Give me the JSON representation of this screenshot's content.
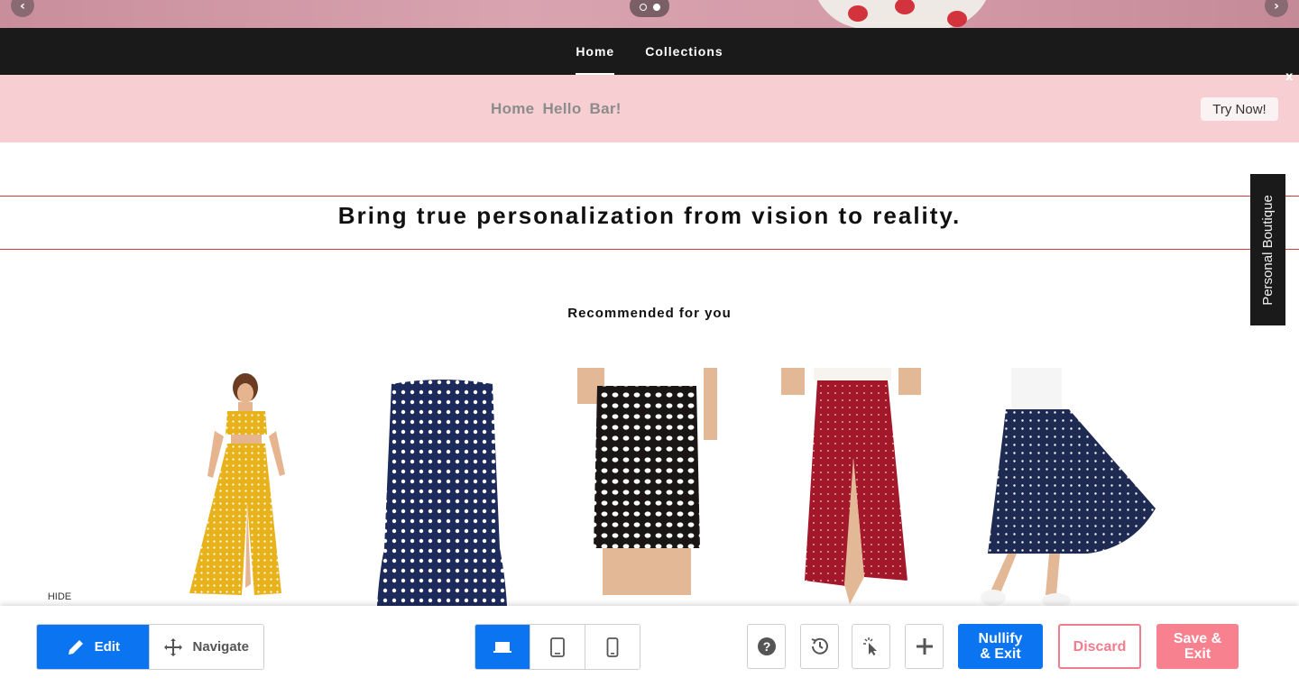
{
  "hero": {
    "prev_icon": "chevron-left-icon",
    "next_icon": "chevron-right-icon",
    "prev_glyph": "‹",
    "next_glyph": "›",
    "slides": 2,
    "active_slide": 2
  },
  "nav": {
    "items": [
      {
        "label": "Home",
        "active": true
      },
      {
        "label": "Collections",
        "active": false
      }
    ]
  },
  "hello_bar": {
    "text": "Home Hello Bar!",
    "cta": "Try Now!",
    "close": "x",
    "background": "#f7cfd2"
  },
  "tagline": "Bring true personalization from vision to reality.",
  "side_tab": "Personal Boutique",
  "recommended": {
    "title": "Recommended for you",
    "products": [
      {
        "name": "yellow-polka-dot-dress",
        "color": "#e8b21b"
      },
      {
        "name": "navy-polka-dot-mermaid-skirt",
        "color": "#1d2a5c"
      },
      {
        "name": "black-polka-dot-pencil-skirt",
        "color": "#1a1616"
      },
      {
        "name": "red-polka-dot-wrap-skirt",
        "color": "#a3172b"
      },
      {
        "name": "navy-polka-dot-midi-skirt",
        "color": "#1e2a52"
      }
    ]
  },
  "toolbar": {
    "hide": "HIDE",
    "mode": {
      "edit": "Edit",
      "edit_icon": "pencil-icon",
      "navigate": "Navigate",
      "navigate_icon": "move-arrows-icon",
      "active": "Edit"
    },
    "devices": [
      {
        "icon": "laptop-icon",
        "active": true
      },
      {
        "icon": "tablet-icon",
        "active": false
      },
      {
        "icon": "mobile-icon",
        "active": false
      }
    ],
    "tools": [
      {
        "icon": "help-icon"
      },
      {
        "icon": "history-icon"
      },
      {
        "icon": "pointer-click-icon"
      },
      {
        "icon": "plus-icon"
      }
    ],
    "nullify_label": "Nullify & Exit",
    "discard_label": "Discard",
    "save_label": "Save & Exit",
    "accent": "#0b74f0",
    "danger": "#f27d8e"
  }
}
